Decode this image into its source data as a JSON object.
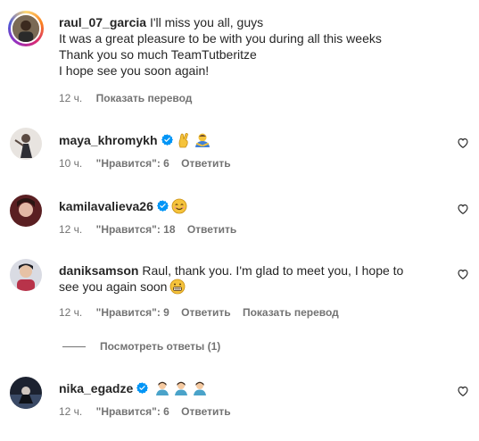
{
  "comments": [
    {
      "username": "raul_07_garcia",
      "lines": [
        "I'll miss you all, guys",
        "It was a great pleasure to be with you during all this weeks",
        "Thank you so much TeamTutberitze",
        "I hope see you soon again!"
      ],
      "time": "12 ч.",
      "translate": "Показать перевод"
    },
    {
      "username": "maya_khromykh",
      "time": "10 ч.",
      "likes": "\"Нравится\": 6",
      "reply": "Ответить"
    },
    {
      "username": "kamilavalieva26",
      "time": "12 ч.",
      "likes": "\"Нравится\": 18",
      "reply": "Ответить"
    },
    {
      "username": "daniksamson",
      "text_line1": "Raul, thank you. I'm glad to meet you, I hope to",
      "text_line2": "see you again soon",
      "time": "12 ч.",
      "likes": "\"Нравится\": 9",
      "reply": "Ответить",
      "translate": "Показать перевод"
    },
    {
      "username": "nika_egadze",
      "time": "12 ч.",
      "likes": "\"Нравится\": 6",
      "reply": "Ответить"
    }
  ],
  "view_replies": "Посмотреть ответы (1)",
  "colors": {
    "verified": "#0095f6",
    "meta_text": "#737373",
    "text": "#262626"
  }
}
